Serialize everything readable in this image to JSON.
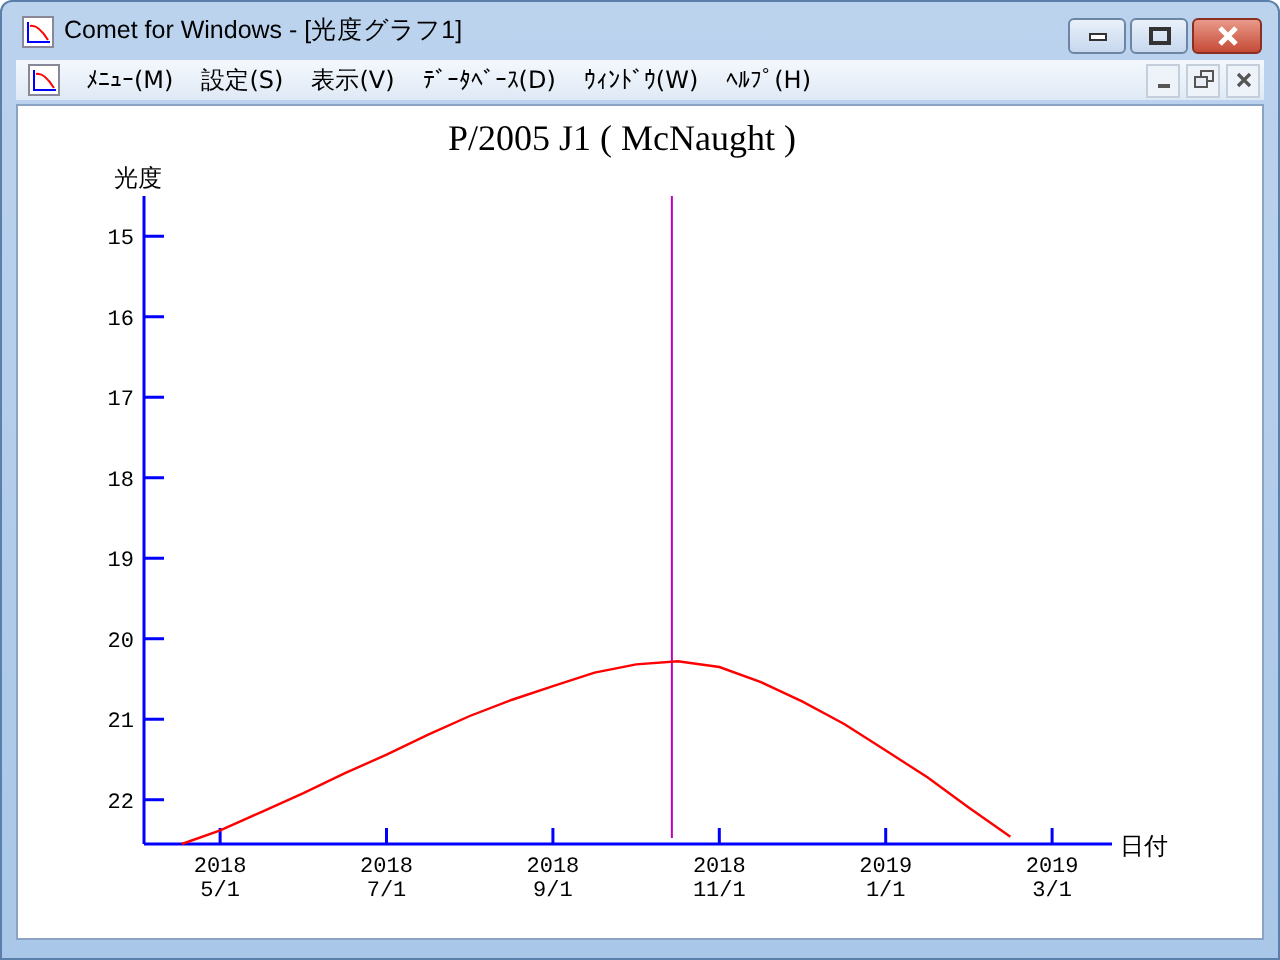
{
  "window": {
    "title": "Comet for Windows - [光度グラフ1]"
  },
  "menu": [
    {
      "label": "ﾒﾆｭｰ(M)"
    },
    {
      "label": "設定(S)"
    },
    {
      "label": "表示(V)"
    },
    {
      "label": "ﾃﾞｰﾀﾍﾞｰｽ(D)"
    },
    {
      "label": "ｳｨﾝﾄﾞｳ(W)"
    },
    {
      "label": "ﾍﾙﾌﾟ(H)"
    }
  ],
  "graph": {
    "chart_data": {
      "type": "line",
      "title": "P/2005 J1 ( McNaught )",
      "xlabel": "日付",
      "ylabel": "光度",
      "categories": [
        null,
        "2018\n5/1",
        null,
        null,
        null,
        "2018\n7/1",
        null,
        null,
        null,
        "2018\n9/1",
        null,
        null,
        null,
        "2018\n11/1",
        null,
        null,
        null,
        "2019\n1/1",
        null,
        null,
        null,
        "2019\n3/1"
      ],
      "series": [
        {
          "color": "#ff0000",
          "values": [
            22.55,
            22.38,
            22.15,
            21.92,
            21.67,
            21.44,
            21.19,
            20.96,
            20.76,
            20.59,
            20.42,
            20.32,
            20.28,
            20.35,
            20.54,
            20.78,
            21.06,
            21.39,
            21.72,
            22.1,
            22.46,
            null
          ]
        }
      ],
      "ylim": [
        22.55,
        14.5
      ],
      "yticks": [
        15,
        16,
        17,
        18,
        19,
        20,
        21,
        22
      ]
    }
  }
}
